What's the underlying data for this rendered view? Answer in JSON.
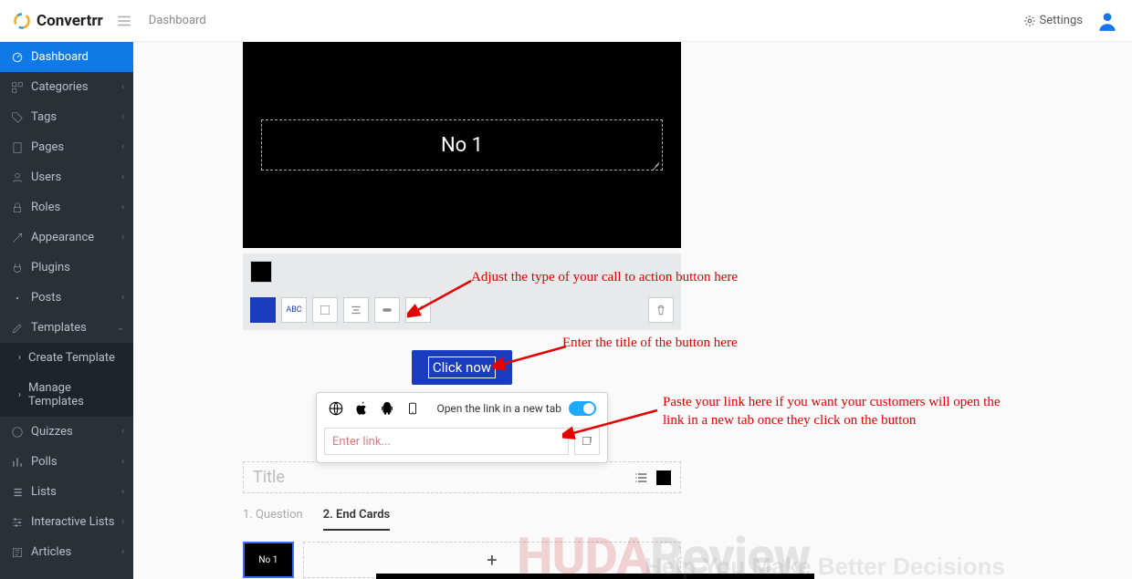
{
  "header": {
    "brand": "Convertrr",
    "breadcrumb": "Dashboard",
    "settings_label": "Settings"
  },
  "sidebar": {
    "items": [
      {
        "label": "Dashboard",
        "icon": "dashboard",
        "active": true
      },
      {
        "label": "Categories",
        "icon": "categories",
        "chev": true
      },
      {
        "label": "Tags",
        "icon": "tags",
        "chev": true
      },
      {
        "label": "Pages",
        "icon": "pages",
        "chev": true
      },
      {
        "label": "Users",
        "icon": "users",
        "chev": true
      },
      {
        "label": "Roles",
        "icon": "roles",
        "chev": true
      },
      {
        "label": "Appearance",
        "icon": "appearance",
        "chev": true
      },
      {
        "label": "Plugins",
        "icon": "plugins"
      },
      {
        "label": "Posts",
        "icon": "posts",
        "chev": true
      },
      {
        "label": "Templates",
        "icon": "templates",
        "chev": true,
        "expanded": true
      },
      {
        "label": "Create Template",
        "icon": "create",
        "sub": true
      },
      {
        "label": "Manage Templates",
        "icon": "manage",
        "sub": true
      },
      {
        "label": "Quizzes",
        "icon": "quizzes",
        "chev": true
      },
      {
        "label": "Polls",
        "icon": "polls",
        "chev": true
      },
      {
        "label": "Lists",
        "icon": "lists",
        "chev": true
      },
      {
        "label": "Interactive Lists",
        "icon": "ilists",
        "chev": true
      },
      {
        "label": "Articles",
        "icon": "articles",
        "chev": true
      }
    ]
  },
  "canvas": {
    "slide_title": "No 1"
  },
  "toolbar": {
    "abc_label": "ABC"
  },
  "cta": {
    "text": "Click now"
  },
  "popover": {
    "newtab_label": "Open the link in a new tab",
    "link_placeholder": "Enter link..."
  },
  "title_section": {
    "placeholder": "Title"
  },
  "tabs": {
    "tab1": "1. Question",
    "tab2": "2. End Cards"
  },
  "thumb": {
    "label": "No 1",
    "add": "+"
  },
  "annotations": {
    "a1": "Adjust the type of your call to action button here",
    "a2": "Enter the title of the button here",
    "a3": "Paste your link here if you want your customers will open the link in a new tab once they click on the button"
  },
  "watermark": {
    "main_a": "HUDA",
    "main_b": "Review",
    "sub": "Help You Make Better Decisions"
  }
}
